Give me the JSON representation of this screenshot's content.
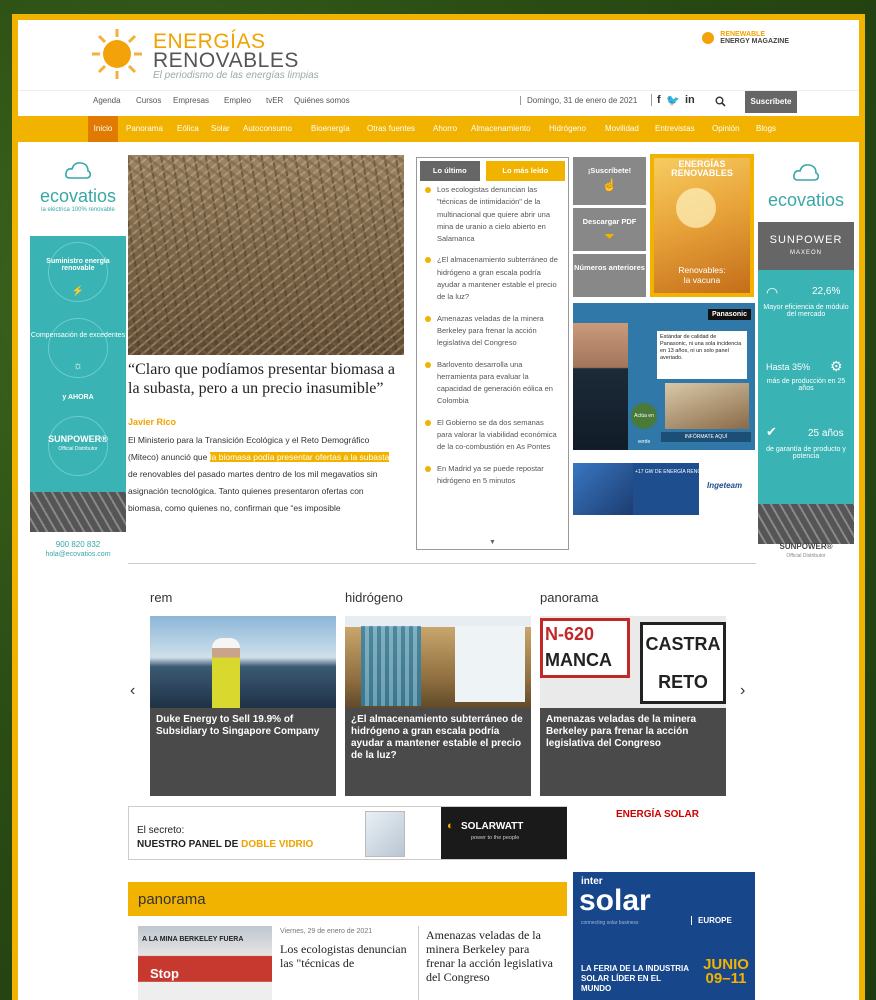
{
  "site": {
    "name_line1": "ENERGÍAS",
    "name_line2": "RENOVABLES",
    "tagline": "El periodismo de las energías limpias",
    "magazine_line1": "RENEWABLE",
    "magazine_line2": "ENERGY MAGAZINE"
  },
  "top_nav": {
    "items": [
      "Agenda",
      "Cursos",
      "Empresas",
      "Empleo",
      "tvER",
      "Quiénes somos"
    ],
    "date": "Domingo, 31 de enero de 2021",
    "social": [
      "f",
      "🐦",
      "in"
    ],
    "subscribe": "Suscríbete"
  },
  "main_nav": {
    "active": "Inicio",
    "items": [
      "Panorama",
      "Eólica",
      "Solar",
      "Autoconsumo",
      "Bioenergía",
      "Otras fuentes",
      "Ahorro",
      "Almacenamiento",
      "Hidrógeno",
      "Movilidad",
      "Entrevistas",
      "Opinión",
      "Blogs"
    ]
  },
  "left_banner": {
    "brand": "ecovatios",
    "sub": "la eléctrica 100% renovable",
    "block1": "Suministro energía renovable",
    "block2": "Compensación de excedentes",
    "block3": "y AHORA",
    "partner": "SUNPOWER®",
    "partner_sub": "Official Distributor",
    "phone": "900 820 832",
    "email": "hola@ecovatios.com"
  },
  "lead_story": {
    "title": "“Claro que podíamos presentar biomasa a la subasta, pero a un precio inasumible”",
    "author": "Javier Rico",
    "body_1": "El Ministerio para la Transición Ecológica y el Reto Demográfico (Miteco) anunció que ",
    "body_link": "la biomasa podía presentar ofertas a la subasta",
    "body_2": " de renovables del pasado martes dentro de los mil megavatios sin asignación tecnológica. Tanto quienes presentaron ofertas con biomasa, como quienes no, confirman que “es imposible"
  },
  "latest": {
    "tab_latest": "Lo último",
    "tab_most_read": "Lo más leído",
    "items": [
      "Los ecologistas denuncian las \"técnicas de intimidación\" de la multinacional que quiere abrir una mina de uranio a cielo abierto en Salamanca",
      "¿El almacenamiento subterráneo de hidrógeno a gran escala podría ayudar a mantener estable el precio de la luz?",
      "Amenazas veladas de la minera Berkeley para frenar la acción legislativa del Congreso",
      "Barlovento desarrolla una herramienta para evaluar la capacidad de generación eólica en Colombia",
      "El Gobierno se da dos semanas para valorar la viabilidad económica de la co-combustión en As Pontes",
      "En Madrid ya se puede repostar hidrógeno en 5 minutos"
    ]
  },
  "sidebar_buttons": {
    "subscribe": "¡Suscríbete!",
    "download": "Descargar PDF",
    "back_issues": "Números anteriores"
  },
  "magazine": {
    "title_1": "ENERGÍAS",
    "title_2": "RENOVABLES",
    "cover_1": "Renovables:",
    "cover_2": "la vacuna"
  },
  "ads": {
    "panasonic_brand": "Panasonic",
    "panasonic_text": "Estándar de calidad de Panasonic, ni una sola incidencia en 13 años, ni un solo panel averiado.",
    "panasonic_cta": "INFÓRMATE AQUÍ",
    "panasonic_badge": "Actúa en verde",
    "ingeteam_brand": "Ingeteam",
    "ingeteam_text": "+17 GW DE ENERGÍA RENOVABLE",
    "solarwatt_line1": "El secreto:",
    "solarwatt_line2a": "NUESTRO PANEL DE ",
    "solarwatt_line2b": "DOBLE VIDRIO",
    "solarwatt_brand": "SOLARWATT",
    "solarwatt_sub": "power to the people",
    "energia_solar": "ENERGÍA SOLAR",
    "intersolar_1": "inter",
    "intersolar_2": "solar",
    "intersolar_3": "connecting solar business",
    "intersolar_4": "EUROPE",
    "intersolar_5": "LA FERIA DE LA INDUSTRIA SOLAR LÍDER EN EL MUNDO",
    "intersolar_6": "JUNIO 09–11"
  },
  "right_banner": {
    "brand": "ecovatios",
    "sp": "SUNPOWER",
    "sp_sub": "MAXEON",
    "stat1_val": "22,6%",
    "stat1_txt": "Mayor eficiencia de módulo del mercado",
    "stat2_val": "Hasta 35%",
    "stat2_txt": "más de producción en 25 años",
    "stat3_val": "25 años",
    "stat3_txt": "de garantía de producto y potencia",
    "partner": "SUNPOWER®",
    "partner_sub": "Official Distributor"
  },
  "carousel": {
    "cards": [
      {
        "category": "rem",
        "title": "Duke Energy to Sell 19.9% of Subsidiary to Singapore Company"
      },
      {
        "category": "hidrógeno",
        "title": "¿El almacenamiento subterráneo de hidrógeno a gran escala podría ayudar a mantener estable el precio de la luz?"
      },
      {
        "category": "panorama",
        "title": "Amenazas veladas de la minera Berkeley para frenar la acción legislativa del Congreso"
      }
    ],
    "sign_1": "N-620",
    "sign_2": "MANCA",
    "sign_3": "CASTRA",
    "sign_4": "RETO"
  },
  "panorama": {
    "heading": "panorama",
    "date": "Viernes, 29 de enero de 2021",
    "title_1": "Los ecologistas denuncian las \"técnicas de",
    "title_2": "Amenazas veladas de la minera Berkeley para frenar la acción legislativa del Congreso",
    "img_sign": "A LA MINA BERKELEY FUERA",
    "img_stop": "Stop"
  }
}
